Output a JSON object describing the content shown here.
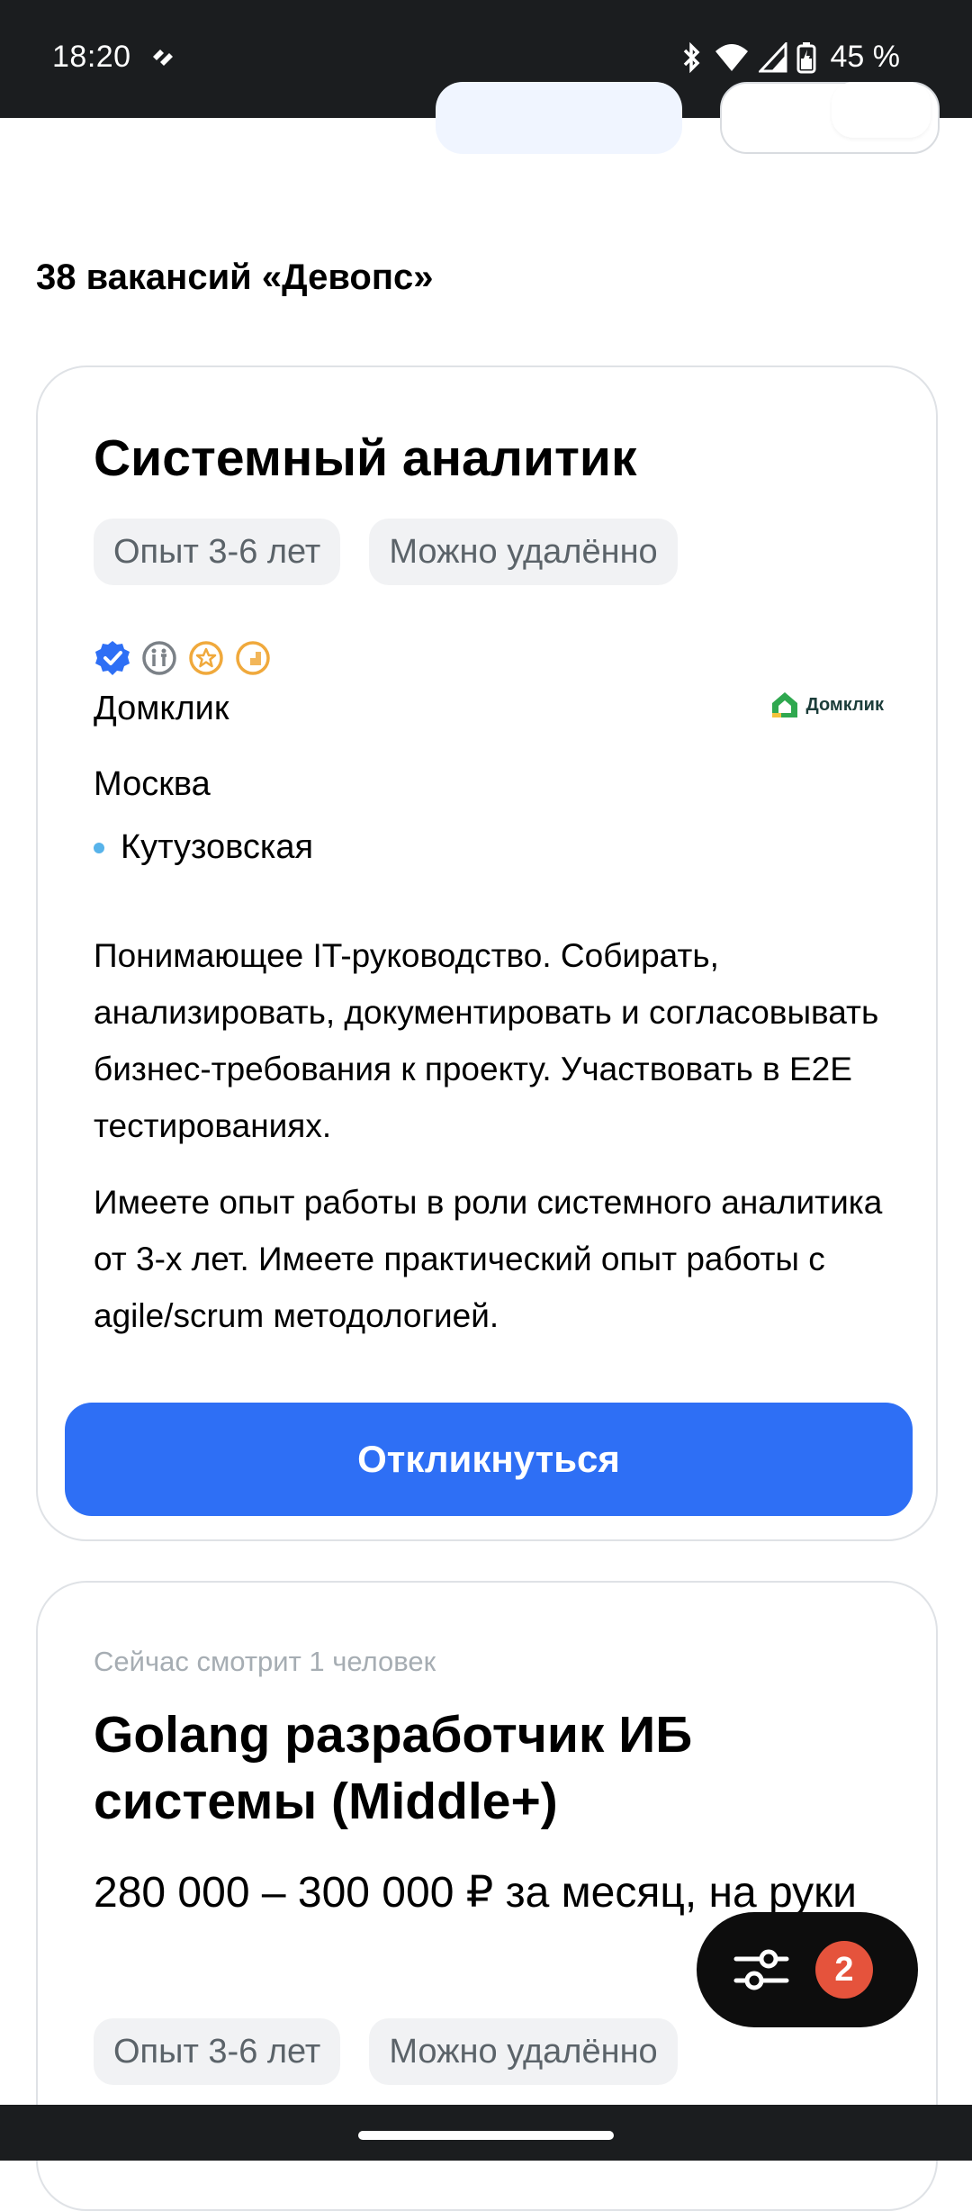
{
  "status_bar": {
    "time": "18:20",
    "battery": "45 %",
    "icons": [
      "app-notification-icon",
      "bluetooth-icon",
      "wifi-icon",
      "signal-icon",
      "battery-icon"
    ]
  },
  "results": {
    "count_label": "38 вакансий «Девопс»"
  },
  "vacancies": [
    {
      "title": "Системный аналитик",
      "tags": [
        "Опыт 3-6 лет",
        "Можно удалённо"
      ],
      "badges": [
        "verified-icon",
        "accessibility-icon",
        "rating-icon",
        "growth-icon"
      ],
      "company": "Домклик",
      "company_logo_text": "Домклик",
      "city": "Москва",
      "metro": "Кутузовская",
      "description": [
        "Понимающее IT-руководство. Собирать, анализировать, документировать и согласовывать бизнес-требования к проекту. Участвовать в E2E тестированиях.",
        "Имеете опыт работы в роли системного аналитика от 3-х лет. Имеете практический опыт работы с agile/scrum методологией."
      ],
      "apply_label": "Откликнуться"
    },
    {
      "viewers": "Сейчас смотрит 1 человек",
      "title": "Golang разработчик ИБ системы (Middle+)",
      "salary": "280 000 – 300 000 ₽ за месяц, на руки",
      "tags": [
        "Опыт 3-6 лет",
        "Можно удалённо"
      ]
    }
  ],
  "filter_fab": {
    "count": "2"
  },
  "colors": {
    "primary": "#2e6ff5",
    "badge_red": "#e5533c",
    "metro_line": "#57b3ea",
    "brand_green": "#2fa84f"
  }
}
